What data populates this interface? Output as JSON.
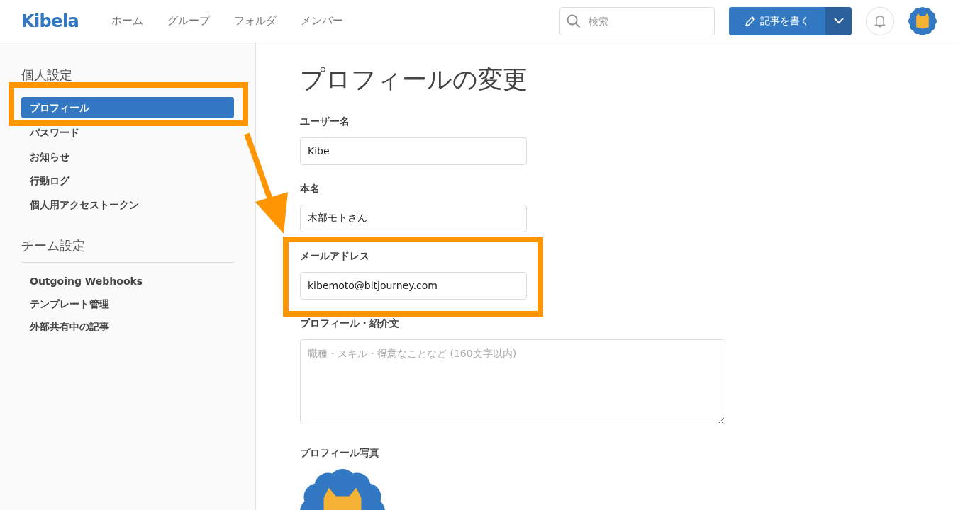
{
  "header": {
    "logo": "Kibela",
    "nav": [
      {
        "label": "ホーム"
      },
      {
        "label": "グループ"
      },
      {
        "label": "フォルダ"
      },
      {
        "label": "メンバー"
      }
    ],
    "search": {
      "placeholder": "検索"
    },
    "write_button": "記事を書く"
  },
  "sidebar": {
    "sections": [
      {
        "title": "個人設定",
        "divider": false,
        "items": [
          {
            "label": "プロフィール",
            "selected": true
          },
          {
            "label": "パスワード",
            "selected": false
          },
          {
            "label": "お知らせ",
            "selected": false
          },
          {
            "label": "行動ログ",
            "selected": false
          },
          {
            "label": "個人用アクセストークン",
            "selected": false
          }
        ]
      },
      {
        "title": "チーム設定",
        "divider": true,
        "items": [
          {
            "label": "Outgoing Webhooks",
            "selected": false
          },
          {
            "label": "テンプレート管理",
            "selected": false
          },
          {
            "label": "外部共有中の記事",
            "selected": false
          }
        ]
      }
    ]
  },
  "page_title": "プロフィールの変更",
  "fields": [
    {
      "label": "ユーザー名",
      "kind": "input",
      "value": "Kibe"
    },
    {
      "label": "本名",
      "kind": "input",
      "value": "木部モトさん"
    },
    {
      "label": "メールアドレス",
      "kind": "input",
      "value": "kibemoto@bitjourney.com"
    },
    {
      "label": "プロフィール・紹介文",
      "kind": "textarea",
      "placeholder": "職種・スキル・得意なことなど (160文字以内)"
    },
    {
      "label": "プロフィール写真",
      "kind": "photo"
    }
  ],
  "annotations": [
    {
      "kind": "box"
    },
    {
      "kind": "arrow"
    },
    {
      "kind": "box"
    }
  ]
}
